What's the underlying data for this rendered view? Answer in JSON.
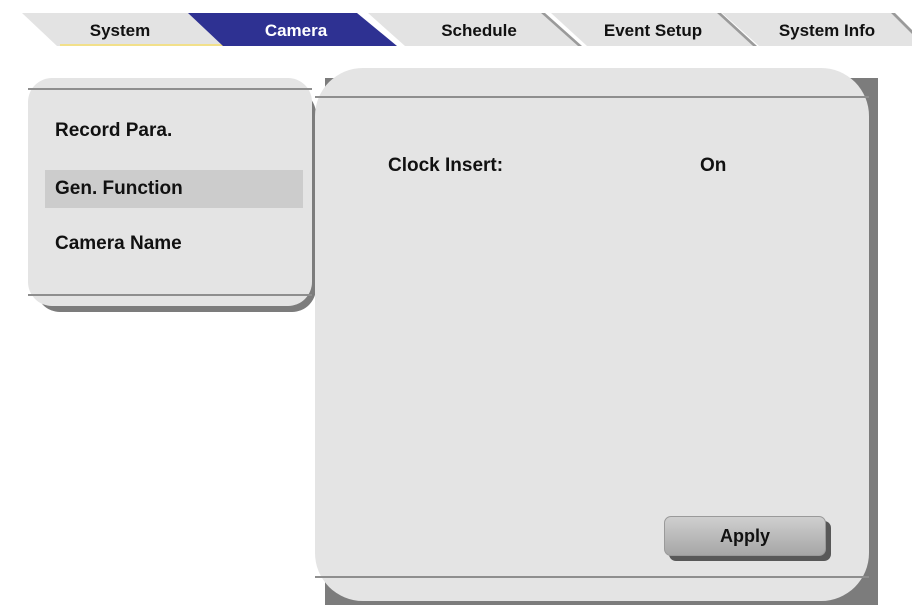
{
  "tabs": [
    {
      "label": "System",
      "active": false
    },
    {
      "label": "Camera",
      "active": true
    },
    {
      "label": "Schedule",
      "active": false
    },
    {
      "label": "Event Setup",
      "active": false
    },
    {
      "label": "System Info",
      "active": false
    }
  ],
  "sidebar": {
    "items": [
      {
        "label": "Record Para.",
        "selected": false
      },
      {
        "label": "Gen. Function",
        "selected": true
      },
      {
        "label": "Camera Name",
        "selected": false
      }
    ]
  },
  "main": {
    "clock_insert": {
      "label": "Clock Insert:",
      "value": "On"
    },
    "apply_label": "Apply"
  },
  "colors": {
    "active_tab": "#2e3192",
    "inactive_tab": "#e3e3e3",
    "tab_underline": "#f2e08a",
    "panel": "#e4e4e4",
    "shadow": "#7c7c7c"
  }
}
